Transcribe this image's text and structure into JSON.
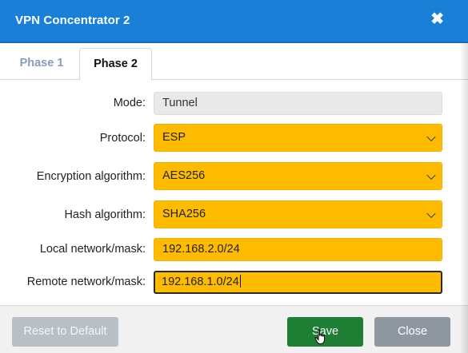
{
  "window": {
    "title": "VPN Concentrator 2",
    "close_glyph": "✖"
  },
  "tabs": [
    {
      "label": "Phase 1",
      "active": false
    },
    {
      "label": "Phase 2",
      "active": true
    }
  ],
  "form": {
    "mode": {
      "label": "Mode:",
      "value": "Tunnel"
    },
    "protocol": {
      "label": "Protocol:",
      "value": "ESP"
    },
    "encryption": {
      "label": "Encryption algorithm:",
      "value": "AES256"
    },
    "hash": {
      "label": "Hash algorithm:",
      "value": "SHA256"
    },
    "local_network": {
      "label": "Local network/mask:",
      "value": "192.168.2.0/24"
    },
    "remote_network": {
      "label": "Remote network/mask:",
      "value": "192.168.1.0/24"
    }
  },
  "footer": {
    "reset_label": "Reset to Default",
    "save_label": "Save",
    "close_label": "Close"
  },
  "colors": {
    "titlebar": "#1a7fd6",
    "field_highlight": "#ffbb00",
    "save_button": "#1e7e34",
    "close_button": "#8e979f",
    "reset_button": "#b8bfc6"
  }
}
